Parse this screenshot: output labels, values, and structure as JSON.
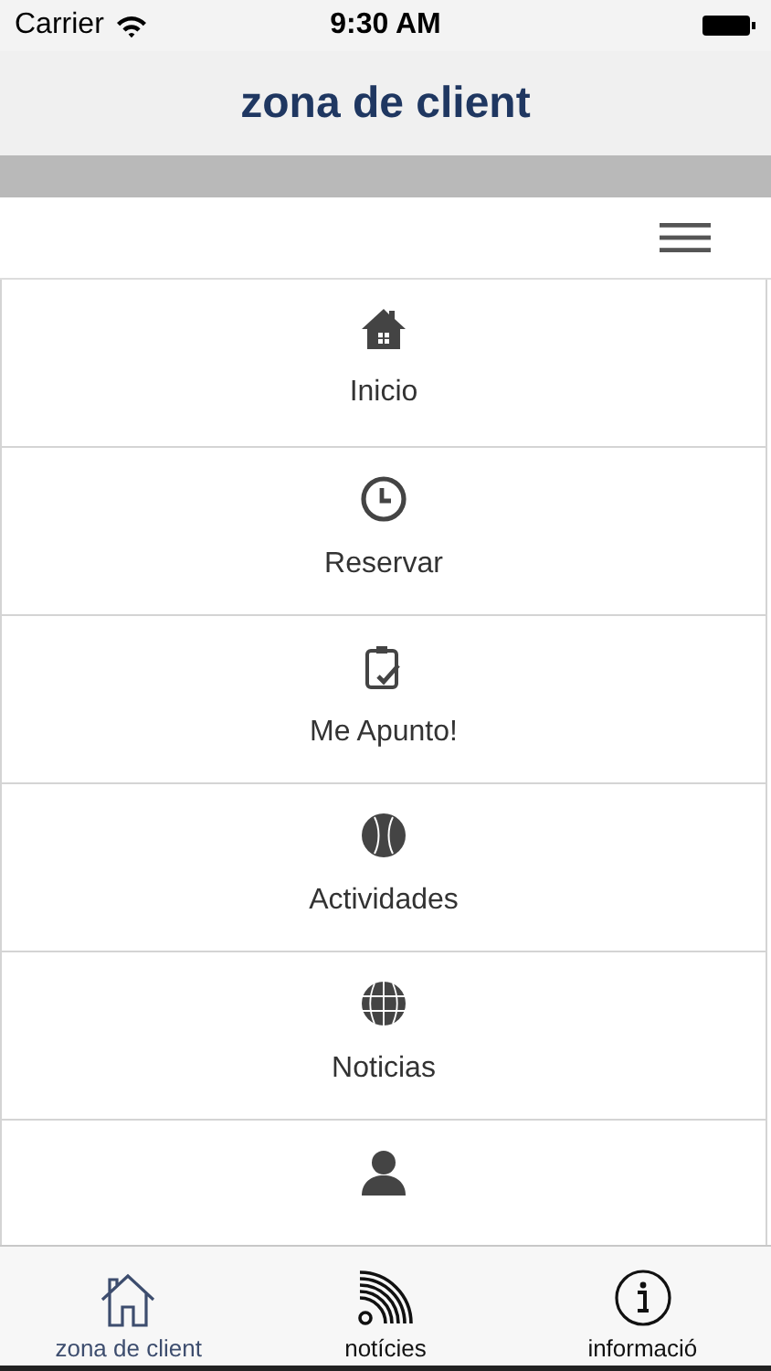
{
  "status_bar": {
    "carrier": "Carrier",
    "time": "9:30 AM"
  },
  "nav_bar": {
    "title": "zona de client"
  },
  "menu_items": [
    {
      "kind": "home",
      "label": "Inicio"
    },
    {
      "kind": "clock",
      "label": "Reservar"
    },
    {
      "kind": "clipboard",
      "label": "Me Apunto!"
    },
    {
      "kind": "ball",
      "label": "Actividades"
    },
    {
      "kind": "globe",
      "label": "Noticias"
    },
    {
      "kind": "person"
    }
  ],
  "tab_bar": [
    {
      "kind": "home",
      "label": "zona de client",
      "selected": true
    },
    {
      "kind": "feed",
      "label": "notícies",
      "selected": false
    },
    {
      "kind": "info",
      "label": "informació",
      "selected": false
    }
  ]
}
